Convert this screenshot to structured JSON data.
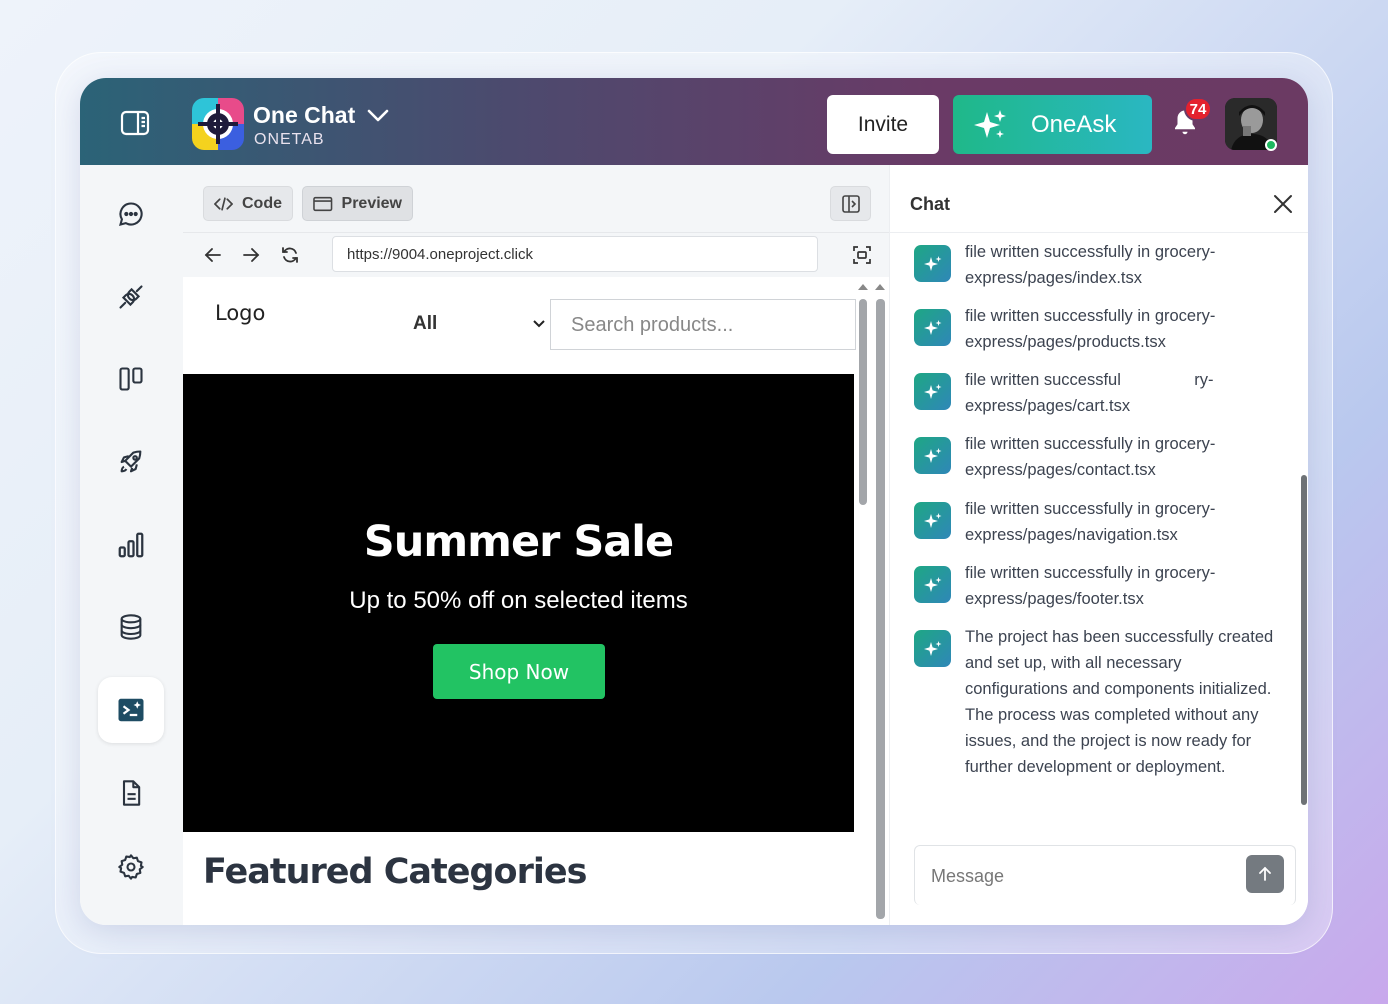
{
  "header": {
    "app_name": "One Chat",
    "workspace": "ONETAB",
    "invite_label": "Invite",
    "oneask_label": "OneAsk",
    "notification_count": "74"
  },
  "sidebar": {
    "items": [
      {
        "name": "chat",
        "active": false
      },
      {
        "name": "integrations",
        "active": false
      },
      {
        "name": "boards",
        "active": false
      },
      {
        "name": "launch",
        "active": false
      },
      {
        "name": "analytics",
        "active": false
      },
      {
        "name": "database",
        "active": false
      },
      {
        "name": "ai-builder",
        "active": true
      },
      {
        "name": "documents",
        "active": false
      },
      {
        "name": "settings",
        "active": false
      }
    ]
  },
  "editor": {
    "tabs": [
      {
        "label": "Code",
        "icon": "code-icon"
      },
      {
        "label": "Preview",
        "icon": "browser-window-icon"
      }
    ],
    "url": "https://9004.oneproject.click"
  },
  "site": {
    "logo_alt": "Logo",
    "category_selected": "All",
    "search_placeholder": "Search products...",
    "hero_title": "Summer Sale",
    "hero_subtitle": "Up to 50% off on selected items",
    "cta_label": "Shop Now",
    "section_title": "Featured Categories"
  },
  "chat": {
    "title": "Chat",
    "messages": [
      {
        "text": "file written successfully in grocery-express/pages/index.tsx"
      },
      {
        "text": "file written successfully in grocery-express/pages/products.tsx"
      },
      {
        "text": "file written successful                ry-express/pages/cart.tsx"
      },
      {
        "text": "file written successfully in grocery-express/pages/contact.tsx"
      },
      {
        "text": "file written successfully in grocery-express/pages/navigation.tsx"
      },
      {
        "text": "file written successfully in grocery-express/pages/footer.tsx"
      },
      {
        "text": "The project has been successfully created and set up, with all necessary configurations and components initialized. The process was completed without any issues, and the project is now ready for further development or deployment."
      }
    ],
    "message_placeholder": "Message"
  },
  "colors": {
    "accent_green": "#22c363",
    "oneask_gradient_start": "#1fb889",
    "oneask_gradient_end": "#2ab7c2",
    "badge_red": "#e4212e"
  }
}
